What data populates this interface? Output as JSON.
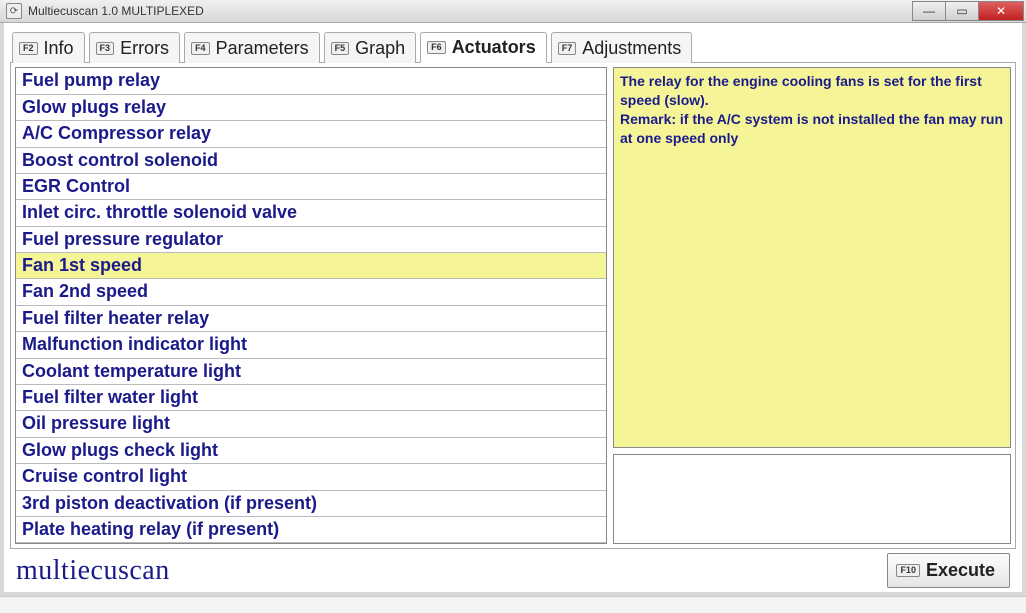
{
  "window": {
    "title": "Multiecuscan 1.0 MULTIPLEXED"
  },
  "tabs": [
    {
      "fkey": "F2",
      "label": "Info"
    },
    {
      "fkey": "F3",
      "label": "Errors"
    },
    {
      "fkey": "F4",
      "label": "Parameters"
    },
    {
      "fkey": "F5",
      "label": "Graph"
    },
    {
      "fkey": "F6",
      "label": "Actuators"
    },
    {
      "fkey": "F7",
      "label": "Adjustments"
    }
  ],
  "active_tab_index": 4,
  "actuators": [
    "Fuel pump relay",
    "Glow plugs relay",
    "A/C Compressor relay",
    "Boost control solenoid",
    "EGR Control",
    "Inlet circ. throttle solenoid valve",
    "Fuel pressure regulator",
    "Fan 1st speed",
    "Fan 2nd speed",
    "Fuel filter heater relay",
    "Malfunction indicator light",
    "Coolant temperature light",
    "Fuel filter water light",
    "Oil pressure light",
    "Glow plugs check light",
    "Cruise control light",
    "3rd piston deactivation (if present)",
    "Plate heating relay (if present)"
  ],
  "selected_actuator_index": 7,
  "description": "The relay for the engine cooling fans is set for the first speed (slow).\nRemark: if the A/C system is not installed the fan may run at one speed only",
  "footer": {
    "brand": "multiecuscan",
    "execute_fkey": "F10",
    "execute_label": "Execute"
  }
}
